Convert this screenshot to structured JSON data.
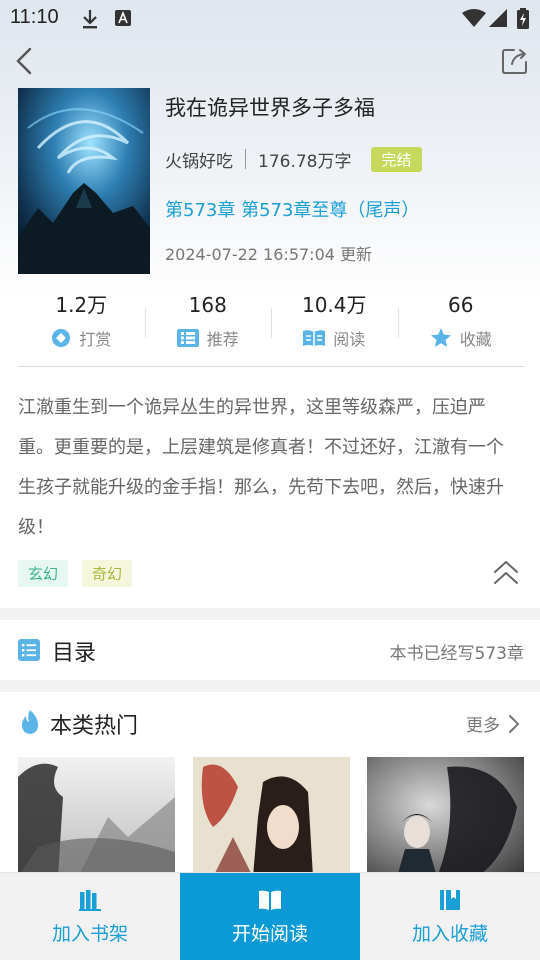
{
  "status_bar": {
    "time": "11:10",
    "icons": [
      "download-icon",
      "app-a-icon",
      "wifi-icon",
      "signal-icon",
      "battery-charging-icon"
    ]
  },
  "nav": {
    "back_icon": "chevron-left-icon",
    "share_icon": "share-icon"
  },
  "book": {
    "title": "我在诡异世界多子多福",
    "author": "火锅好吃",
    "word_count": "176.78万字",
    "status": "完结",
    "latest_chapter": "第573章 第573章至尊（尾声）",
    "update_time": "2024-07-22 16:57:04 更新"
  },
  "stats": [
    {
      "value": "1.2万",
      "label": "打赏",
      "icon": "reward-icon"
    },
    {
      "value": "168",
      "label": "推荐",
      "icon": "recommend-icon"
    },
    {
      "value": "10.4万",
      "label": "阅读",
      "icon": "read-book-icon"
    },
    {
      "value": "66",
      "label": "收藏",
      "icon": "star-icon"
    }
  ],
  "description": "江澈重生到一个诡异丛生的异世界，这里等级森严，压迫严重。更重要的是，上层建筑是修真者！不过还好，江澈有一个生孩子就能升级的金手指！那么，先苟下去吧，然后，快速升级！",
  "tags": [
    "玄幻",
    "奇幻"
  ],
  "catalog": {
    "title": "目录",
    "count_text": "本书已经写573章"
  },
  "hot": {
    "title": "本类热门",
    "more_label": "更多"
  },
  "bottom_bar": {
    "add_shelf": "加入书架",
    "start_reading": "开始阅读",
    "add_collection": "加入收藏"
  },
  "colors": {
    "accent": "#1a9fd6",
    "primary_button": "#0b9ad6",
    "done_badge": "#c6d95c"
  }
}
